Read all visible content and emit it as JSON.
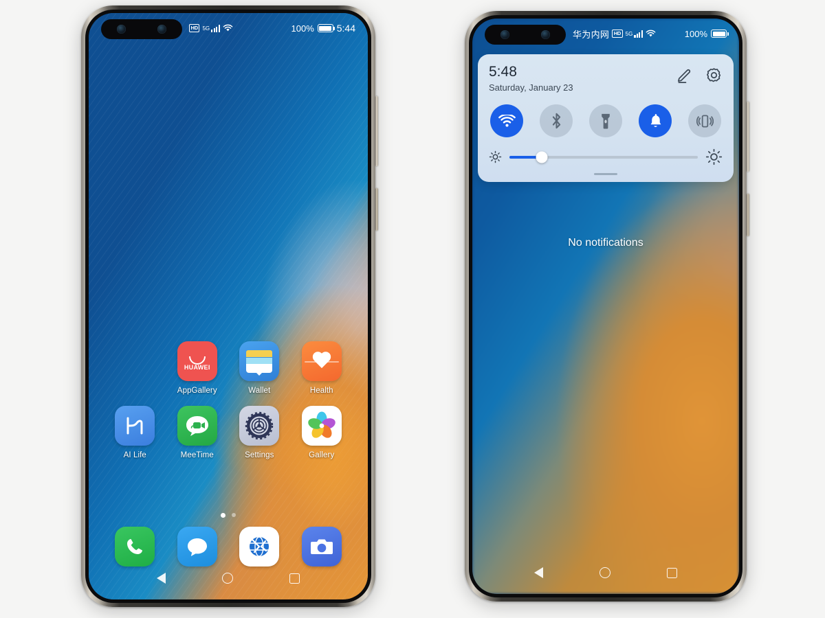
{
  "background_color": "#f5f5f4",
  "phones": {
    "left": {
      "name": "huawei-home-screen",
      "statusbar": {
        "carrier": "",
        "hd_badge": "HD",
        "network_gen": "5G",
        "battery_percent": "100%",
        "clock": "5:44"
      },
      "apps_row1": [
        {
          "label": "",
          "icon": "empty-slot"
        },
        {
          "label": "AppGallery",
          "icon": "appgallery-icon",
          "brand_text": "HUAWEI",
          "color": "#ef5350"
        },
        {
          "label": "Wallet",
          "icon": "wallet-icon",
          "color": "#3f8fe0"
        },
        {
          "label": "Health",
          "icon": "health-icon",
          "color": "#f7762f"
        }
      ],
      "apps_row2": [
        {
          "label": "AI Life",
          "icon": "ailife-icon",
          "color": "#4b8ee7"
        },
        {
          "label": "MeeTime",
          "icon": "meetime-icon",
          "color": "#2db14e"
        },
        {
          "label": "Settings",
          "icon": "settings-icon",
          "color": "#c6ccdc"
        },
        {
          "label": "Gallery",
          "icon": "gallery-icon",
          "color": "#ffffff"
        }
      ],
      "page_indicator": {
        "total": 2,
        "active": 1
      },
      "dock": [
        {
          "label": "Phone",
          "icon": "phone-icon",
          "color": "#2cb954"
        },
        {
          "label": "Messages",
          "icon": "messages-icon",
          "color": "#2b99ea"
        },
        {
          "label": "Browser",
          "icon": "browser-icon",
          "color": "#1f6fd0"
        },
        {
          "label": "Camera",
          "icon": "camera-icon",
          "color": "#4b73e3"
        }
      ],
      "navbar": [
        {
          "label": "Back",
          "icon": "back-triangle-icon"
        },
        {
          "label": "Home",
          "icon": "home-circle-icon"
        },
        {
          "label": "Recents",
          "icon": "recents-square-icon"
        }
      ]
    },
    "right": {
      "name": "huawei-notification-shade",
      "statusbar": {
        "carrier": "华为内网",
        "hd_badge": "HD",
        "network_gen": "5G",
        "battery_percent": "100%",
        "clock": ""
      },
      "quick_settings": {
        "time": "5:48",
        "date": "Saturday, January 23",
        "actions": [
          {
            "label": "Edit",
            "icon": "pencil-edit-icon"
          },
          {
            "label": "Settings",
            "icon": "gear-icon"
          }
        ],
        "toggles": [
          {
            "label": "Wi-Fi",
            "icon": "wifi-icon",
            "active": true
          },
          {
            "label": "Bluetooth",
            "icon": "bluetooth-icon",
            "active": false
          },
          {
            "label": "Flashlight",
            "icon": "flashlight-icon",
            "active": false
          },
          {
            "label": "Sound",
            "icon": "bell-icon",
            "active": true
          },
          {
            "label": "Vibrate",
            "icon": "vibrate-icon",
            "active": false
          }
        ],
        "brightness": {
          "label": "Brightness",
          "value_percent": 17
        },
        "grip": "drag-handle"
      },
      "notifications_empty_text": "No notifications",
      "navbar": [
        {
          "label": "Back",
          "icon": "back-triangle-icon"
        },
        {
          "label": "Home",
          "icon": "home-circle-icon"
        },
        {
          "label": "Recents",
          "icon": "recents-square-icon"
        }
      ]
    }
  },
  "colors": {
    "accent_blue": "#1a5fe8",
    "panel_bg": "#d6e3f1",
    "toggle_off": "#96a5b6"
  }
}
